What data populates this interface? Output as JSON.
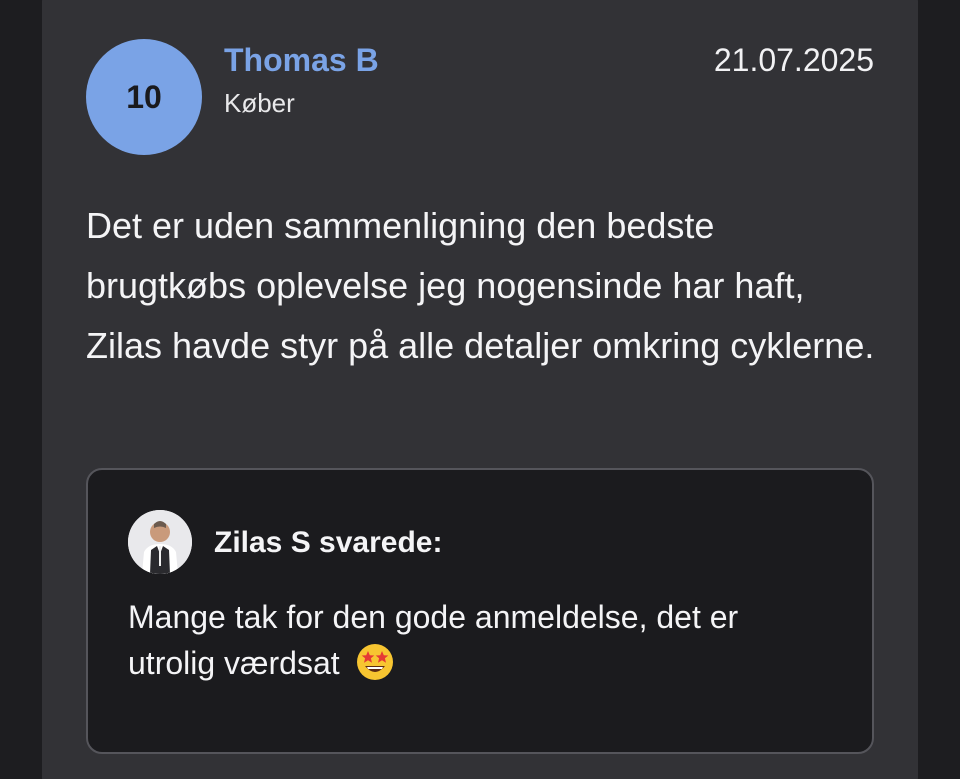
{
  "review": {
    "score": "10",
    "reviewer_name": "Thomas B",
    "reviewer_role": "Køber",
    "date": "21.07.2025",
    "text": "Det er uden sammenligning den bedste brugtkøbs oplevelse jeg nogensinde har haft, Zilas havde styr på alle detaljer omkring cyklerne."
  },
  "reply": {
    "author_label": "Zilas S svarede:",
    "text": "Mange tak for den gode anmeldelse, det er utrolig værdsat",
    "emoji_icon": "star-struck-emoji-icon"
  },
  "colors": {
    "accent": "#7aa3e6",
    "card_bg": "#323236",
    "reply_bg": "#1b1b1e"
  }
}
